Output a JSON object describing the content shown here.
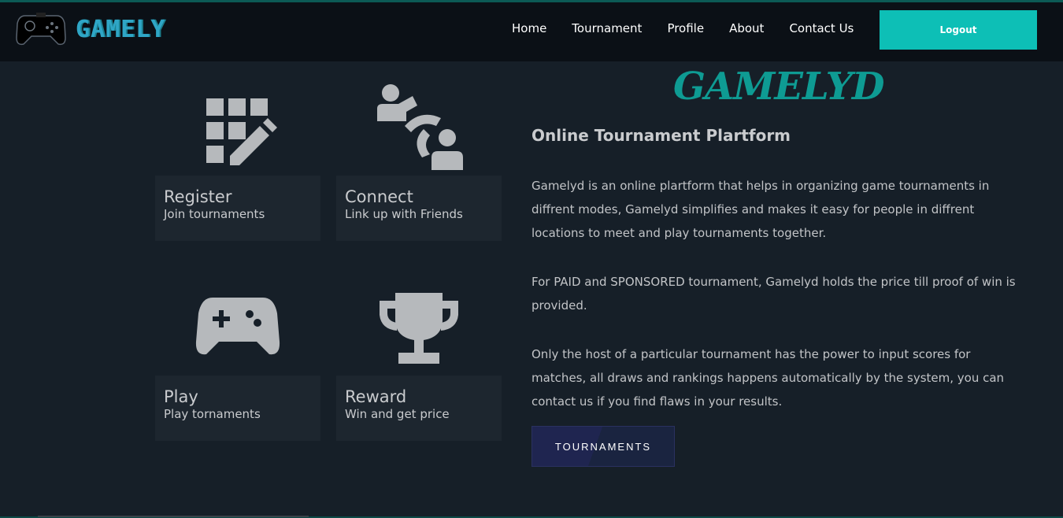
{
  "header": {
    "logo_text": "GAMELY",
    "nav": [
      "Home",
      "Tournament",
      "Profile",
      "About",
      "Contact Us"
    ],
    "logout_label": "Logout"
  },
  "features": [
    {
      "title": "Register",
      "subtitle": "Join tournaments",
      "icon": "register-grid-pencil-icon"
    },
    {
      "title": "Connect",
      "subtitle": "Link up with Friends",
      "icon": "connect-users-icon"
    },
    {
      "title": "Play",
      "subtitle": "Play tornaments",
      "icon": "gamepad-icon"
    },
    {
      "title": "Reward",
      "subtitle": "Win and get price",
      "icon": "trophy-icon"
    }
  ],
  "main": {
    "brand_title": "GAMELYD",
    "subtitle": "Online Tournament Plartform",
    "paragraphs": [
      "Gamelyd is an online plartform that helps in organizing game tournaments in diffrent modes, Gamelyd simplifies and makes it easy for people in diffrent locations to meet and play tournaments together.",
      "For PAID and SPONSORED tournament, Gamelyd holds the price till proof of win is provided.",
      "Only the host of a particular tournament has the power to input scores for matches, all draws and rankings happens automatically by the system, you can contact us if you find flaws in your results."
    ],
    "cta_label": "TOURNAMENTS"
  },
  "colors": {
    "accent": "#0dbfb6",
    "brand_title": "#0e9b93",
    "background": "#161f28",
    "header": "#0b1016",
    "card": "#1d262f",
    "icon": "#b6b9bc"
  }
}
